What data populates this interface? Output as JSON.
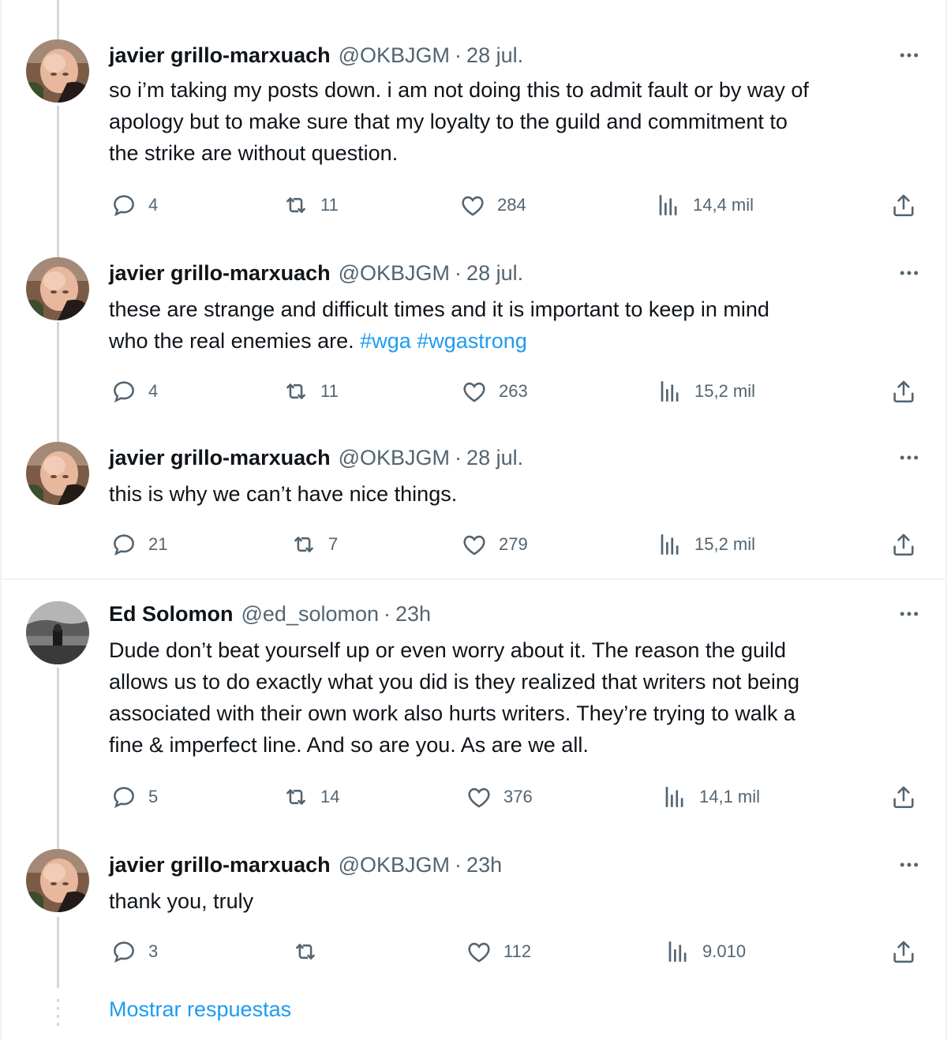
{
  "tweets": [
    {
      "name": "javier grillo-marxuach",
      "handle": "@OKBJGM",
      "time": "28 jul.",
      "lines": [
        "so i’m taking my posts down. i am not doing this to admit fault or by way of",
        "apology but to make sure that my loyalty to the guild and commitment to",
        "the strike are without question."
      ],
      "replies": "4",
      "retweets": "11",
      "likes": "284",
      "views": "14,4 mil"
    },
    {
      "name": "javier grillo-marxuach",
      "handle": "@OKBJGM",
      "time": "28 jul.",
      "line1": "these are strange and difficult times and it is important to keep in mind",
      "line2": "who the real enemies are.",
      "hashtag1": "#wga",
      "hashtag2": "#wgastrong",
      "replies": "4",
      "retweets": "11",
      "likes": "263",
      "views": "15,2 mil"
    },
    {
      "name": "javier grillo-marxuach",
      "handle": "@OKBJGM",
      "time": "28 jul.",
      "lines": [
        "this is why we can’t have nice things."
      ],
      "replies": "21",
      "retweets": "7",
      "likes": "279",
      "views": "15,2 mil"
    },
    {
      "name": "Ed Solomon",
      "handle": "@ed_solomon",
      "time": "23h",
      "lines": [
        "Dude don’t beat yourself up or even worry about it. The reason the guild",
        "allows us to do exactly what you did is they realized that writers not being",
        "associated with their own work also hurts writers. They’re trying to walk a",
        "fine & imperfect line. And so are you. As are we all."
      ],
      "replies": "5",
      "retweets": "14",
      "likes": "376",
      "views": "14,1 mil"
    },
    {
      "name": "javier grillo-marxuach",
      "handle": "@OKBJGM",
      "time": "23h",
      "lines": [
        "thank you, truly"
      ],
      "replies": "3",
      "retweets": "",
      "likes": "112",
      "views": "9.010"
    }
  ],
  "separator": "·",
  "show_replies": "Mostrar respuestas",
  "colors": {
    "link": "#1d9bf0",
    "secondary": "#536471",
    "text": "#0f1419",
    "thread_line": "#cfd9de"
  },
  "icons": [
    "reply-icon",
    "retweet-icon",
    "like-icon",
    "views-icon",
    "share-icon",
    "more-options-icon"
  ]
}
